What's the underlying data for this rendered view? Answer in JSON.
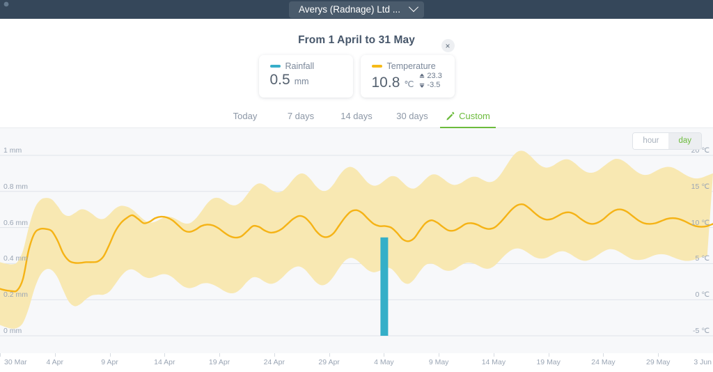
{
  "topbar": {
    "org_label": "Averys (Radnage) Ltd ...",
    "chevron_icon": "chevron-down-icon",
    "background": "#35475a"
  },
  "header": {
    "range_title": "From 1 April to 31 May",
    "close_label": "×",
    "cards": [
      {
        "key": "rainfall",
        "legend": "Rainfall",
        "color": "#37aec9",
        "value": "0.5",
        "unit": "mm"
      },
      {
        "key": "temperature",
        "legend": "Temperature",
        "color": "#f6ba18",
        "value": "10.8",
        "unit": "℃",
        "max": "23.3",
        "min": "-3.5"
      }
    ]
  },
  "tabs": [
    {
      "label": "Today",
      "active": false
    },
    {
      "label": "7 days",
      "active": false
    },
    {
      "label": "14 days",
      "active": false
    },
    {
      "label": "30 days",
      "active": false
    },
    {
      "label": "Custom",
      "active": true,
      "icon": "pencil-icon"
    }
  ],
  "unit_toggle": {
    "options": [
      "hour",
      "day"
    ],
    "selected": "day"
  },
  "chart_data": {
    "type": "area",
    "title": "From 1 April to 31 May",
    "xlabel": "",
    "grid": true,
    "legend_position": "top",
    "x_ticks": [
      "30 Mar",
      "4 Apr",
      "9 Apr",
      "14 Apr",
      "19 Apr",
      "24 Apr",
      "29 Apr",
      "4 May",
      "9 May",
      "14 May",
      "19 May",
      "24 May",
      "29 May",
      "3 Jun"
    ],
    "left_axis": {
      "label": "Rainfall",
      "unit": "mm",
      "ticks": [
        "0 mm",
        "0.2 mm",
        "0.4 mm",
        "0.6 mm",
        "0.8 mm",
        "1 mm"
      ],
      "ylim": [
        0,
        1
      ]
    },
    "right_axis": {
      "label": "Temperature",
      "unit": "℃",
      "ticks": [
        "-5 ℃",
        "0 ℃",
        "5 ℃",
        "10 ℃",
        "15 ℃",
        "20 ℃"
      ],
      "ylim": [
        -5,
        20
      ]
    },
    "series": [
      {
        "name": "Temperature",
        "type": "line",
        "color": "#f5b316",
        "unit": "℃",
        "values": [
          1.5,
          1.3,
          1.2,
          1.3,
          2.9,
          6.9,
          9.2,
          9.8,
          9.8,
          9.5,
          8.2,
          6.4,
          5.4,
          5.1,
          5.1,
          5.2,
          5.2,
          5.3,
          6.0,
          7.6,
          9.4,
          10.6,
          11.3,
          11.7,
          11.2,
          10.6,
          10.8,
          11.3,
          11.5,
          11.4,
          11.0,
          10.3,
          9.6,
          9.4,
          9.7,
          10.2,
          10.4,
          10.3,
          9.9,
          9.3,
          8.8,
          8.6,
          8.8,
          9.5,
          10.2,
          10.1,
          9.6,
          9.3,
          9.4,
          9.8,
          10.5,
          11.2,
          11.6,
          11.4,
          10.6,
          9.5,
          8.8,
          8.7,
          9.2,
          10.3,
          11.4,
          12.2,
          12.4,
          12.0,
          11.2,
          10.5,
          10.2,
          10.2,
          10.0,
          9.3,
          8.4,
          8.1,
          8.5,
          9.6,
          10.6,
          11.0,
          10.7,
          10.1,
          9.6,
          9.6,
          10.0,
          10.5,
          10.6,
          10.4,
          10.0,
          9.8,
          10.0,
          10.7,
          11.6,
          12.5,
          13.1,
          13.2,
          12.7,
          12.0,
          11.4,
          11.1,
          11.2,
          11.6,
          12.0,
          12.1,
          11.8,
          11.2,
          10.7,
          10.5,
          10.7,
          11.2,
          11.9,
          12.4,
          12.5,
          12.2,
          11.6,
          11.0,
          10.6,
          10.5,
          10.6,
          10.9,
          11.2,
          11.3,
          11.2,
          10.9,
          10.5,
          10.2,
          10.1,
          10.2,
          10.5
        ]
      },
      {
        "name": "Temperature range",
        "type": "band",
        "color": "#f8e8b2",
        "unit": "℃",
        "min_values": [
          -3.5,
          -3.8,
          -4.0,
          -3.9,
          -3.2,
          -1.2,
          1.5,
          3.4,
          4.2,
          4.1,
          3.1,
          1.3,
          -0.3,
          -0.9,
          -0.6,
          0.1,
          0.6,
          0.7,
          0.7,
          1.1,
          2.1,
          3.2,
          4.0,
          4.2,
          3.8,
          3.2,
          3.0,
          3.2,
          3.5,
          3.5,
          3.1,
          2.4,
          1.8,
          1.6,
          1.8,
          2.2,
          2.3,
          2.1,
          1.7,
          1.2,
          0.9,
          1.0,
          1.6,
          2.5,
          3.1,
          3.0,
          2.5,
          2.2,
          2.4,
          3.0,
          3.8,
          4.4,
          4.6,
          4.2,
          3.3,
          2.4,
          2.0,
          2.3,
          3.2,
          4.4,
          5.4,
          5.8,
          5.5,
          4.8,
          4.1,
          3.8,
          4.0,
          4.4,
          4.3,
          3.5,
          2.5,
          2.2,
          2.8,
          3.9,
          4.8,
          5.0,
          4.7,
          4.2,
          4.0,
          4.2,
          4.7,
          5.1,
          5.1,
          4.8,
          4.4,
          4.3,
          4.7,
          5.5,
          6.3,
          6.9,
          7.1,
          6.9,
          6.4,
          5.9,
          5.7,
          5.8,
          6.2,
          6.6,
          6.7,
          6.4,
          5.9,
          5.5,
          5.4,
          5.7,
          6.2,
          6.7,
          7.0,
          6.9,
          6.5,
          6.0,
          5.6,
          5.5,
          5.6,
          5.9,
          6.2,
          6.3,
          6.2,
          5.9,
          5.6,
          5.4,
          5.4,
          5.6,
          5.9,
          6.1
        ],
        "max_values": [
          5.2,
          5.0,
          4.9,
          5.2,
          6.8,
          10.0,
          12.6,
          13.8,
          14.1,
          13.9,
          13.0,
          11.9,
          11.6,
          12.0,
          12.5,
          12.4,
          11.9,
          11.3,
          11.2,
          11.8,
          12.6,
          13.0,
          12.9,
          12.5,
          11.8,
          11.1,
          10.7,
          10.8,
          11.2,
          11.5,
          11.4,
          11.0,
          10.6,
          10.6,
          11.2,
          12.2,
          13.3,
          14.0,
          14.1,
          13.7,
          13.2,
          13.1,
          13.6,
          14.6,
          15.6,
          16.1,
          15.9,
          15.3,
          14.9,
          15.0,
          15.7,
          16.7,
          17.4,
          17.4,
          16.7,
          15.7,
          15.1,
          15.2,
          16.0,
          17.2,
          18.1,
          18.4,
          18.0,
          17.1,
          16.2,
          15.8,
          16.0,
          16.6,
          17.1,
          17.0,
          16.3,
          15.6,
          15.4,
          15.9,
          16.7,
          17.3,
          17.3,
          16.8,
          16.2,
          15.9,
          16.1,
          16.6,
          17.0,
          17.0,
          16.6,
          16.3,
          16.5,
          17.3,
          18.5,
          19.7,
          20.5,
          20.6,
          20.1,
          19.3,
          18.6,
          18.3,
          18.5,
          19.0,
          19.4,
          19.4,
          18.9,
          18.2,
          17.7,
          17.6,
          17.9,
          18.5,
          19.1,
          19.5,
          19.4,
          18.9,
          18.2,
          17.6,
          17.3,
          17.4,
          17.8,
          18.2,
          18.4,
          18.3,
          17.9,
          17.4,
          17.0,
          16.8,
          16.9,
          17.2,
          17.5
        ]
      },
      {
        "name": "Rainfall",
        "type": "bar",
        "color": "#35afc8",
        "unit": "mm",
        "bars": [
          {
            "x_label": "4 May",
            "value": 0.545
          }
        ]
      }
    ]
  }
}
